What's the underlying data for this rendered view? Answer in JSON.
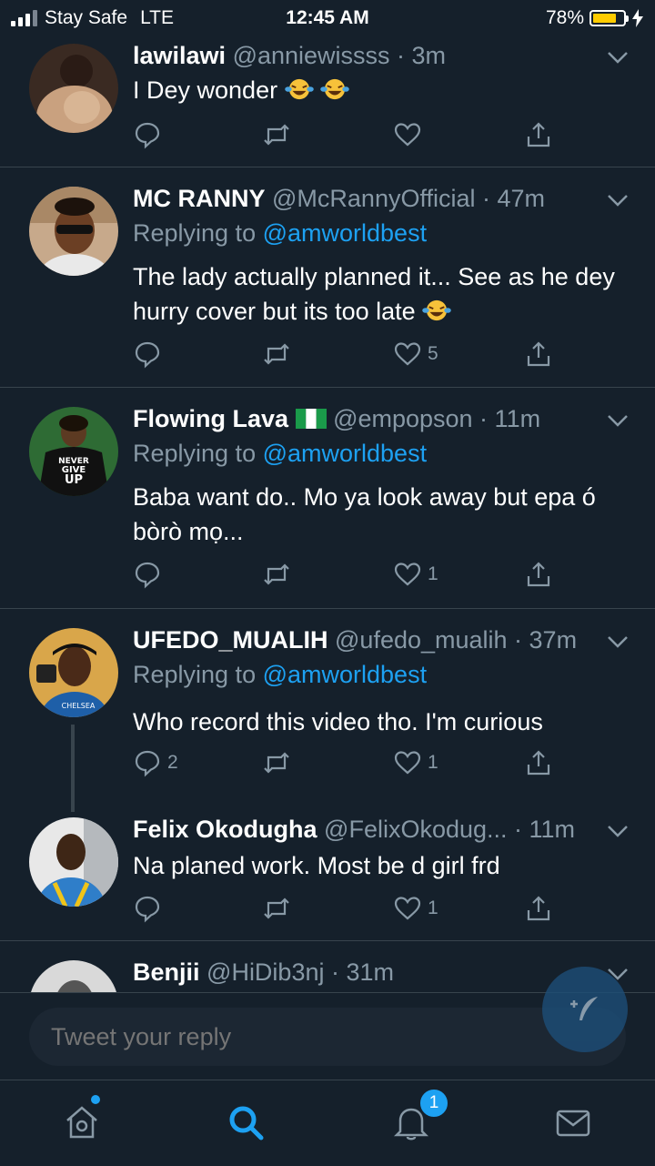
{
  "status_bar": {
    "carrier": "Stay Safe",
    "network": "LTE",
    "time": "12:45 AM",
    "battery_percent": "78%",
    "battery_level": 0.78,
    "battery_color": "#ffcc00"
  },
  "tweets": [
    {
      "name": "lawilawi",
      "handle": "@anniewissss · 3m",
      "text": "I Dey wonder",
      "emoji": [
        "laughing-tears",
        "laughing-tears"
      ],
      "replying_to_label": "",
      "replying_to_handle": "",
      "reply_count": "",
      "retweet_count": "",
      "like_count": ""
    },
    {
      "name": "MC RANNY",
      "handle": "@McRannyOfficial · 47m",
      "replying_to_label": "Replying to",
      "replying_to_handle": "@amworldbest",
      "text": "The lady actually planned it... See as he dey hurry cover but its too late",
      "emoji": [
        "laughing-tears"
      ],
      "reply_count": "",
      "retweet_count": "",
      "like_count": "5"
    },
    {
      "name": "Flowing Lava",
      "handle": "@empopson · 11m",
      "flag": "nigeria-flag",
      "replying_to_label": "Replying to",
      "replying_to_handle": "@amworldbest",
      "text": "Baba want do.. Mo ya look away but epa ó bòrò mọ...",
      "reply_count": "",
      "retweet_count": "",
      "like_count": "1"
    },
    {
      "name": "UFEDO_MUALIH",
      "handle": "@ufedo_mualih · 37m",
      "replying_to_label": "Replying to",
      "replying_to_handle": "@amworldbest",
      "text": "Who record this video tho. I'm curious",
      "reply_count": "2",
      "retweet_count": "",
      "like_count": "1"
    },
    {
      "name": "Felix Okodugha",
      "handle": "@FelixOkodug... · 11m",
      "text": "Na planed work. Most be d girl frd",
      "reply_count": "",
      "retweet_count": "",
      "like_count": "1"
    },
    {
      "name": "Benjii",
      "handle": "@HiDib3nj · 31m"
    }
  ],
  "reply_bar": {
    "placeholder": "Tweet your reply"
  },
  "tab_bar": {
    "notifications_badge": "1",
    "active_tab": "search"
  },
  "colors": {
    "background": "#15202b",
    "accent": "#1da1f2",
    "secondary_text": "#8899a6",
    "divider": "#38444d"
  }
}
